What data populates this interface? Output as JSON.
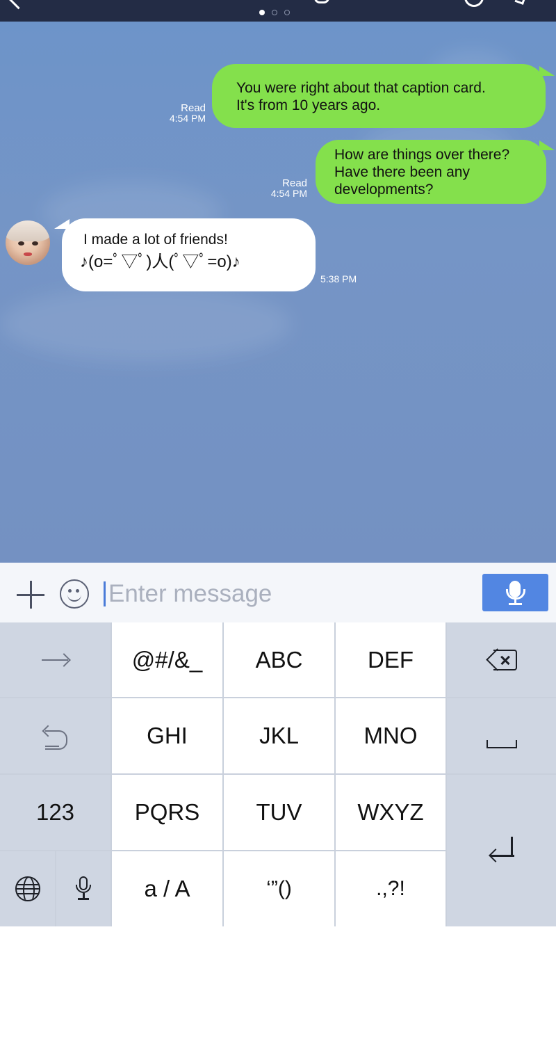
{
  "header": {
    "page_indicator": {
      "count": 3,
      "active": 1
    }
  },
  "conversation": {
    "messages": [
      {
        "side": "outgoing",
        "lines": [
          "You were right about that caption card.",
          "It's from 10 years ago."
        ],
        "status": "Read",
        "time": "4:54 PM"
      },
      {
        "side": "outgoing",
        "lines": [
          "How are things over there?",
          "Have there been any",
          "developments?"
        ],
        "status": "Read",
        "time": "4:54 PM"
      },
      {
        "side": "incoming",
        "lines": [
          "I made a lot of friends!",
          "♪(o=ﾟ▽ﾟ)人(ﾟ▽ﾟ=o)♪"
        ],
        "time": "5:38 PM"
      }
    ]
  },
  "composer": {
    "placeholder": "Enter message",
    "value": ""
  },
  "keyboard": {
    "rows": [
      [
        "→",
        "@#/&_",
        "ABC",
        "DEF",
        "⌫"
      ],
      [
        "↺",
        "GHI",
        "JKL",
        "MNO",
        "␣"
      ],
      [
        "123",
        "PQRS",
        "TUV",
        "WXYZ",
        "⏎"
      ],
      [
        "🌐",
        "🎤",
        "a / A",
        "‘”()",
        ".,?!"
      ]
    ],
    "labels": {
      "symbols": "@#/&_",
      "abc": "ABC",
      "def": "DEF",
      "ghi": "GHI",
      "jkl": "JKL",
      "mno": "MNO",
      "num": "123",
      "pqrs": "PQRS",
      "tuv": "TUV",
      "wxyz": "WXYZ",
      "case": "a / A",
      "quotes": "‘”()",
      "punct": ".,?!"
    }
  },
  "icons": {
    "back": "back-chevron-icon",
    "add": "plus-icon",
    "emoji": "smiley-icon",
    "voice": "microphone-icon",
    "next": "arrow-right-icon",
    "undo": "undo-icon",
    "delete": "backspace-icon",
    "space": "space-icon",
    "enter": "enter-icon",
    "language": "globe-icon"
  },
  "colors": {
    "topbar": "#232c45",
    "chat_bg": "#7595c6",
    "outgoing_bubble": "#84e04c",
    "incoming_bubble": "#ffffff",
    "mic_button": "#5286e2",
    "caret": "#4a7bd8"
  }
}
